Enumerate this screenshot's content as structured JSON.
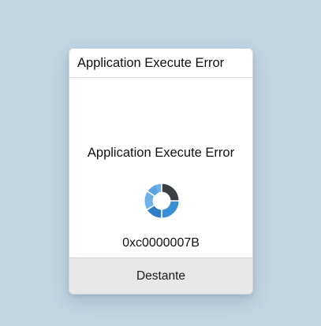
{
  "dialog": {
    "title": "Application Execute Error",
    "message": "Application Execute Error",
    "error_code": "0xc0000007B",
    "button_label": "Destante",
    "spinner_icon": "loading-spinner-icon",
    "colors": {
      "background": "#c2d5e3",
      "spinner_primary": "#3a8fd6",
      "spinner_light": "#6fb2e8",
      "spinner_dark": "#3b3f44",
      "button_bg": "#e7e7e7"
    }
  }
}
